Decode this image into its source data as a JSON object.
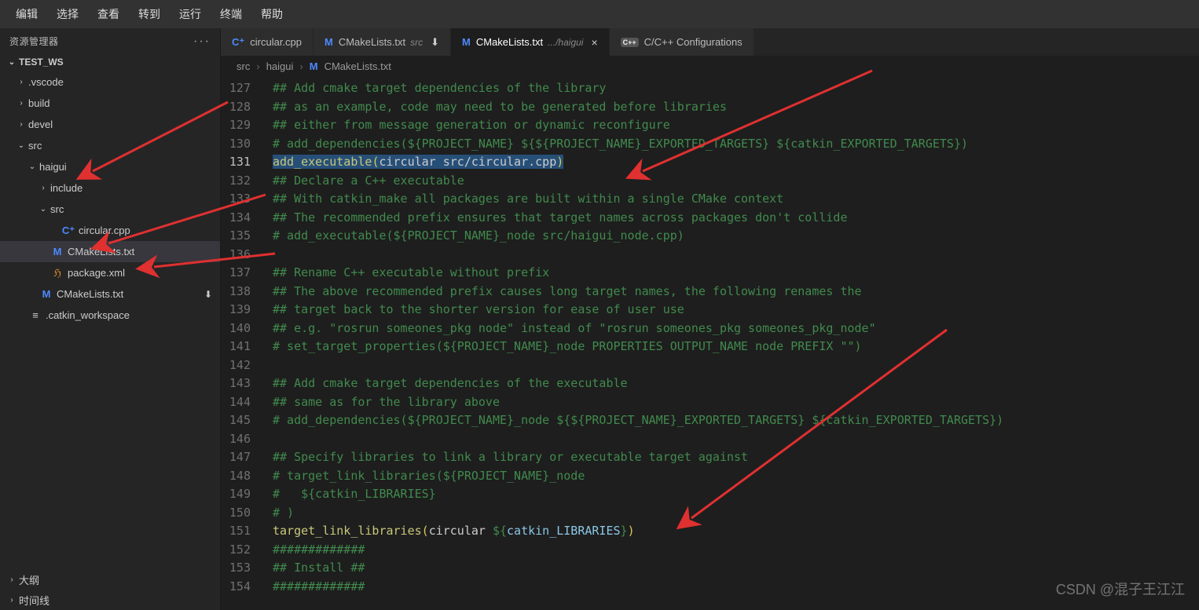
{
  "menubar": [
    "编辑",
    "选择",
    "查看",
    "转到",
    "运行",
    "终端",
    "帮助"
  ],
  "sidebar": {
    "header": "资源管理器",
    "root": "TEST_WS",
    "items": [
      {
        "chev": "›",
        "label": ".vscode",
        "indent": 20
      },
      {
        "chev": "›",
        "label": "build",
        "indent": 20
      },
      {
        "chev": "›",
        "label": "devel",
        "indent": 20
      },
      {
        "chev": "⌄",
        "label": "src",
        "indent": 20
      },
      {
        "chev": "⌄",
        "label": "haigui",
        "indent": 34
      },
      {
        "chev": "›",
        "label": "include",
        "indent": 48
      },
      {
        "chev": "⌄",
        "label": "src",
        "indent": 48
      },
      {
        "chev": "",
        "icon": "cpp",
        "iconTxt": "C⁺",
        "label": "circular.cpp",
        "indent": 62
      },
      {
        "chev": "",
        "icon": "m",
        "iconTxt": "M",
        "label": "CMakeLists.txt",
        "indent": 48,
        "selected": true
      },
      {
        "chev": "",
        "icon": "rss",
        "iconTxt": "ℌ",
        "label": "package.xml",
        "indent": 48
      },
      {
        "chev": "",
        "icon": "m",
        "iconTxt": "M",
        "label": "CMakeLists.txt",
        "indent": 34,
        "modified": "⬇"
      },
      {
        "chev": "",
        "label": ".catkin_workspace",
        "indent": 20,
        "file": true
      }
    ],
    "outline": "大纲",
    "timeline": "时间线"
  },
  "tabs": [
    {
      "icon": "cpp",
      "iconTxt": "C⁺",
      "label": "circular.cpp"
    },
    {
      "icon": "m",
      "iconTxt": "M",
      "label": "CMakeLists.txt",
      "suffix": "src",
      "badge": "⬇"
    },
    {
      "icon": "m",
      "iconTxt": "M",
      "label": "CMakeLists.txt",
      "suffix": ".../haigui",
      "close": "×",
      "active": true
    },
    {
      "icon": "cfg",
      "iconTxt": "C++",
      "label": "C/C++ Configurations"
    }
  ],
  "breadcrumb": [
    "src",
    ">",
    "haigui",
    ">",
    "M",
    "CMakeLists.txt"
  ],
  "code": {
    "start": 127,
    "current": 131,
    "lines": [
      {
        "t": "comment",
        "txt": "## Add cmake target dependencies of the library"
      },
      {
        "t": "comment",
        "txt": "## as an example, code may need to be generated before libraries"
      },
      {
        "t": "comment",
        "txt": "## either from message generation or dynamic reconfigure"
      },
      {
        "t": "comment",
        "txt": "# add_dependencies(${PROJECT_NAME} ${${PROJECT_NAME}_EXPORTED_TARGETS} ${catkin_EXPORTED_TARGETS})"
      },
      {
        "t": "exec",
        "parts": [
          "add_executable",
          "(",
          "circular src/circular.cpp",
          ")"
        ]
      },
      {
        "t": "comment",
        "txt": "## Declare a C++ executable"
      },
      {
        "t": "comment",
        "txt": "## With catkin_make all packages are built within a single CMake context"
      },
      {
        "t": "comment",
        "txt": "## The recommended prefix ensures that target names across packages don't collide"
      },
      {
        "t": "comment",
        "txt": "# add_executable(${PROJECT_NAME}_node src/haigui_node.cpp)"
      },
      {
        "t": "blank",
        "txt": ""
      },
      {
        "t": "comment",
        "txt": "## Rename C++ executable without prefix"
      },
      {
        "t": "comment",
        "txt": "## The above recommended prefix causes long target names, the following renames the"
      },
      {
        "t": "comment",
        "txt": "## target back to the shorter version for ease of user use"
      },
      {
        "t": "comment",
        "txt": "## e.g. \"rosrun someones_pkg node\" instead of \"rosrun someones_pkg someones_pkg_node\""
      },
      {
        "t": "comment",
        "txt": "# set_target_properties(${PROJECT_NAME}_node PROPERTIES OUTPUT_NAME node PREFIX \"\")"
      },
      {
        "t": "blank",
        "txt": ""
      },
      {
        "t": "comment",
        "txt": "## Add cmake target dependencies of the executable"
      },
      {
        "t": "comment",
        "txt": "## same as for the library above"
      },
      {
        "t": "comment",
        "txt": "# add_dependencies(${PROJECT_NAME}_node ${${PROJECT_NAME}_EXPORTED_TARGETS} ${catkin_EXPORTED_TARGETS})"
      },
      {
        "t": "blank",
        "txt": ""
      },
      {
        "t": "comment",
        "txt": "## Specify libraries to link a library or executable target against"
      },
      {
        "t": "comment",
        "txt": "# target_link_libraries(${PROJECT_NAME}_node"
      },
      {
        "t": "comment",
        "txt": "#   ${catkin_LIBRARIES}"
      },
      {
        "t": "comment",
        "txt": "# )"
      },
      {
        "t": "link",
        "parts": [
          "target_link_libraries",
          "(",
          "circular ",
          "${",
          "catkin_LIBRARIES",
          "}",
          ")"
        ]
      },
      {
        "t": "comment",
        "txt": "#############"
      },
      {
        "t": "comment",
        "txt": "## Install ##"
      },
      {
        "t": "comment",
        "txt": "#############"
      }
    ]
  },
  "watermark": "CSDN @混子王江江"
}
